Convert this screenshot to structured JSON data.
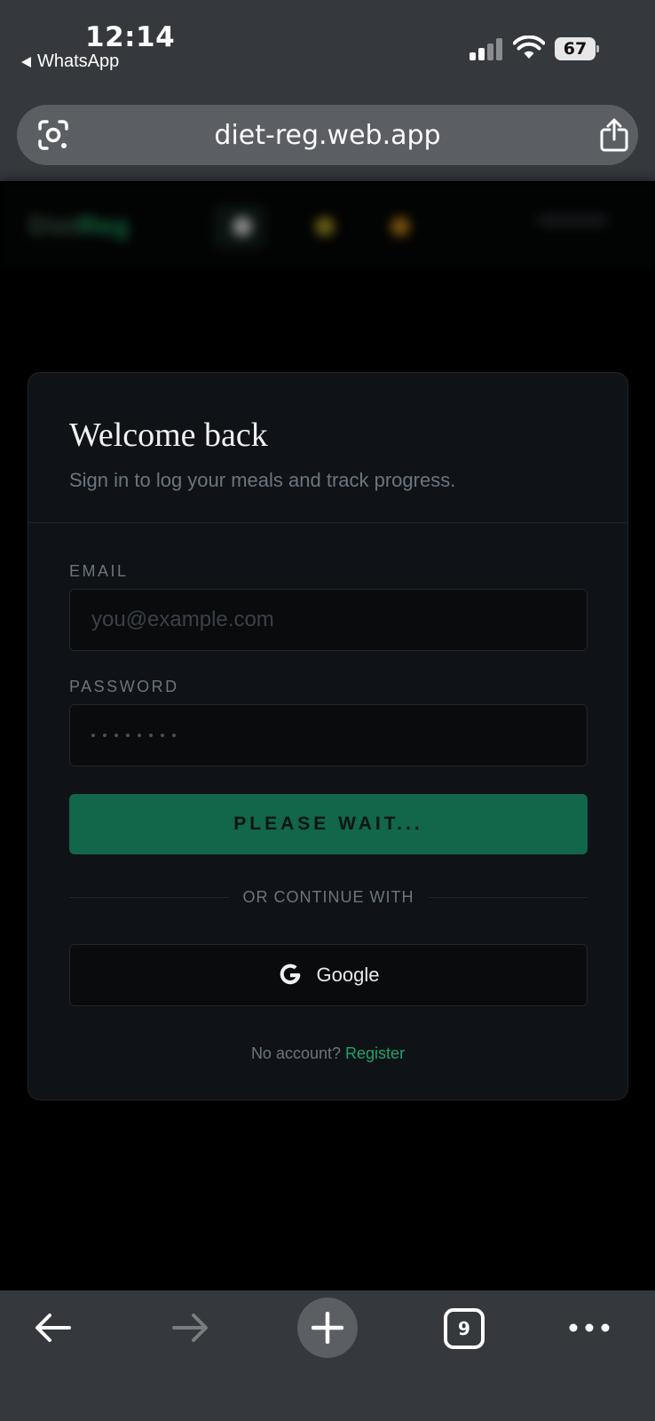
{
  "status_bar": {
    "time": "12:14",
    "back_app": "WhatsApp",
    "battery_level": "67",
    "signal_icon": "signal-icon",
    "wifi_icon": "wifi-icon"
  },
  "browser": {
    "url": "diet-reg.web.app",
    "lens_icon": "lens-icon",
    "share_icon": "share-icon",
    "tab_count": "9",
    "toolbar_icons": [
      "back-arrow-icon",
      "forward-arrow-icon",
      "new-tab-plus-icon",
      "tabs-icon",
      "more-icon"
    ]
  },
  "login": {
    "title": "Welcome back",
    "subtitle": "Sign in to log your meals and track progress.",
    "email_label": "EMAIL",
    "email_placeholder": "you@example.com",
    "password_label": "PASSWORD",
    "submit_label": "PLEASE WAIT...",
    "divider_text": "OR CONTINUE WITH",
    "google_label": "Google",
    "footer_prompt": "No account?",
    "register_link": "Register"
  },
  "colors": {
    "accent": "#12664a",
    "link": "#1fa36d",
    "card_bg": "#0f1216",
    "chrome_bg": "#35383c"
  }
}
